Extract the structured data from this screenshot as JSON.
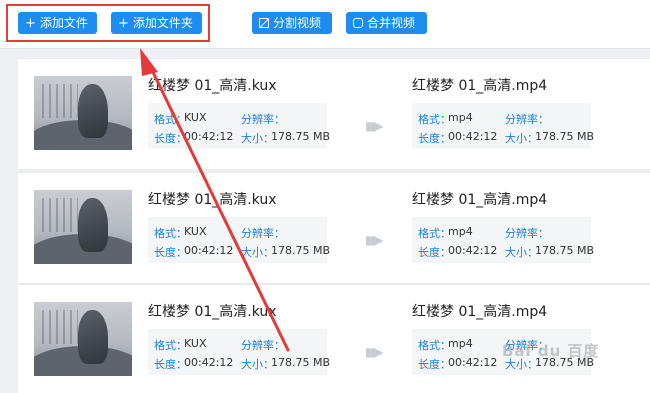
{
  "toolbar": {
    "add_file_label": "添加文件",
    "add_folder_label": "添加文件夹",
    "split_label": "分割视频",
    "merge_label": "合并视频",
    "accent_color": "#1d8df0"
  },
  "annotation": {
    "highlight_color": "#e43a3a"
  },
  "labels": {
    "format": "格式：",
    "resolution": "分辨率：",
    "duration": "长度：",
    "size": "大小："
  },
  "files": [
    {
      "source_name": "红楼梦 01_高清.kux",
      "source_format": "KUX",
      "source_duration": "00:42:12",
      "source_size": "178.75 MB",
      "target_name": "红楼梦 01_高清.mp4",
      "target_format": "mp4",
      "target_duration": "00:42:12",
      "target_size": "178.75 MB"
    },
    {
      "source_name": "红楼梦 01_高清.kux",
      "source_format": "KUX",
      "source_duration": "00:42:12",
      "source_size": "178.75 MB",
      "target_name": "红楼梦 01_高清.mp4",
      "target_format": "mp4",
      "target_duration": "00:42:12",
      "target_size": "178.75 MB"
    },
    {
      "source_name": "红楼梦 01_高清.kux",
      "source_format": "KUX",
      "source_duration": "00:42:12",
      "source_size": "178.75 MB",
      "target_name": "红楼梦 01_高清.mp4",
      "target_format": "mp4",
      "target_duration": "00:42:12",
      "target_size": "178.75 MB"
    }
  ],
  "watermark": "Bai du 百度"
}
